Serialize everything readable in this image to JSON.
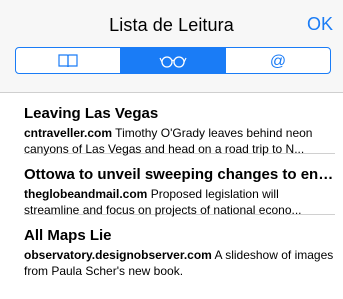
{
  "header": {
    "title": "Lista de Leitura",
    "ok_label": "OK"
  },
  "segments": [
    {
      "icon": "book-icon",
      "active": false
    },
    {
      "icon": "glasses-icon",
      "active": true
    },
    {
      "icon": "at-icon",
      "active": false
    }
  ],
  "items": [
    {
      "title": "Leaving Las Vegas",
      "source": "cntraveller.com",
      "text": " Timothy O'Grady leaves behind neon canyons of Las Vegas and head on a road trip to N..."
    },
    {
      "title": "Ottowa to unveil sweeping changes to envi...",
      "source": "theglobeandmail.com",
      "text": " Proposed legislation will streamline and focus on projects of national econo..."
    },
    {
      "title": "All Maps Lie",
      "source": "observatory.designobserver.com",
      "text": " A slideshow of images from Paula Scher's new book."
    }
  ],
  "colors": {
    "accent": "#1a7cf6",
    "header_bg": "#f7f7f7"
  }
}
